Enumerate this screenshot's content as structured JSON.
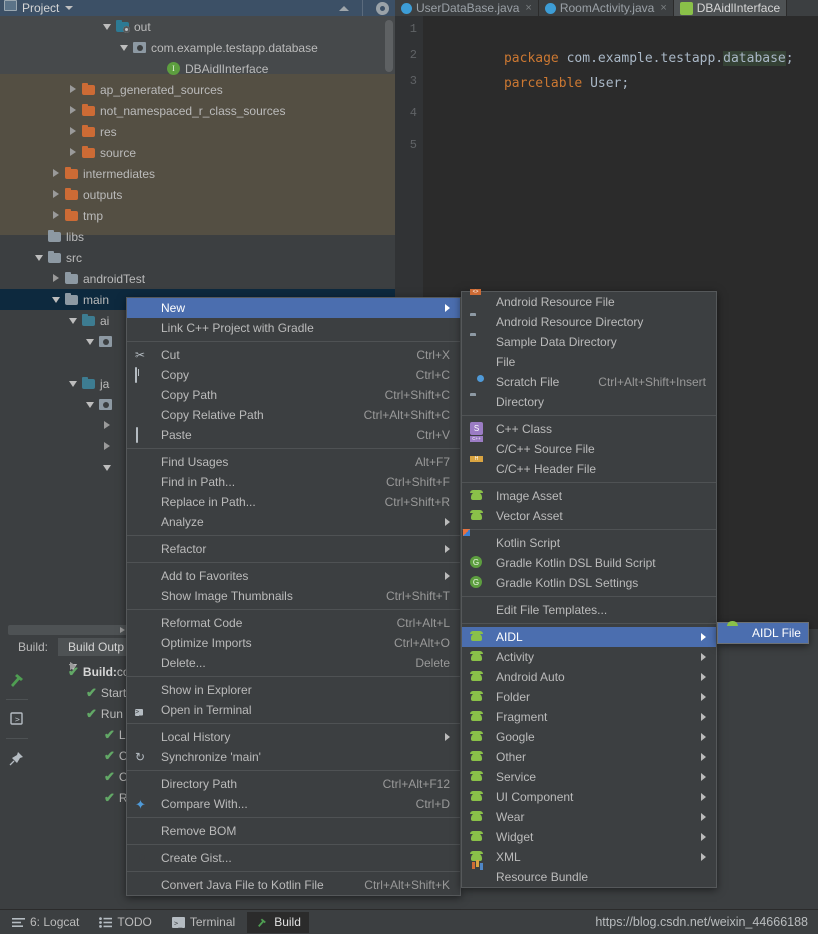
{
  "project_toolbar": {
    "title": "Project",
    "collapse_icon": "collapse-all-icon",
    "settings_icon": "gear-icon"
  },
  "project_tree": {
    "items": [
      {
        "indent": 6,
        "twisty": "down",
        "icon": "folder-out",
        "label": "out",
        "band": "out"
      },
      {
        "indent": 7,
        "twisty": "down",
        "icon": "package",
        "label": "com.example.testapp.database",
        "band": "out"
      },
      {
        "indent": 9,
        "twisty": "none",
        "icon": "interface",
        "label": "DBAidlInterface",
        "band": "out"
      },
      {
        "indent": 4,
        "twisty": "right",
        "icon": "folder-orange",
        "label": "ap_generated_sources",
        "band": "olive"
      },
      {
        "indent": 4,
        "twisty": "right",
        "icon": "folder-orange",
        "label": "not_namespaced_r_class_sources",
        "band": "olive"
      },
      {
        "indent": 4,
        "twisty": "right",
        "icon": "folder-orange",
        "label": "res",
        "band": "olive"
      },
      {
        "indent": 4,
        "twisty": "right",
        "icon": "folder-orange",
        "label": "source",
        "band": "olive"
      },
      {
        "indent": 3,
        "twisty": "right",
        "icon": "folder-orange",
        "label": "intermediates",
        "band": "olive"
      },
      {
        "indent": 3,
        "twisty": "right",
        "icon": "folder-orange",
        "label": "outputs",
        "band": "olive"
      },
      {
        "indent": 3,
        "twisty": "right",
        "icon": "folder-orange",
        "label": "tmp",
        "band": "olive"
      },
      {
        "indent": 2,
        "twisty": "none",
        "icon": "folder-grey",
        "label": "libs",
        "band": "none"
      },
      {
        "indent": 2,
        "twisty": "down",
        "icon": "folder-grey",
        "label": "src",
        "band": "none"
      },
      {
        "indent": 3,
        "twisty": "right",
        "icon": "folder-grey",
        "label": "androidTest",
        "band": "none"
      },
      {
        "indent": 3,
        "twisty": "down",
        "icon": "folder-grey",
        "label": "main",
        "band": "selected"
      },
      {
        "indent": 4,
        "twisty": "down",
        "icon": "folder-teal",
        "label": "ai",
        "band": "none"
      },
      {
        "indent": 5,
        "twisty": "down",
        "icon": "package",
        "label": "",
        "band": "none"
      },
      {
        "indent": 4,
        "twisty": "none",
        "icon": "none",
        "label": "",
        "band": "none"
      },
      {
        "indent": 4,
        "twisty": "down",
        "icon": "folder-teal",
        "label": "ja",
        "band": "none"
      },
      {
        "indent": 5,
        "twisty": "down",
        "icon": "package",
        "label": "",
        "band": "none"
      },
      {
        "indent": 6,
        "twisty": "right",
        "icon": "none",
        "label": "",
        "band": "none"
      },
      {
        "indent": 6,
        "twisty": "right",
        "icon": "none",
        "label": "",
        "band": "none"
      },
      {
        "indent": 6,
        "twisty": "down",
        "icon": "none",
        "label": "",
        "band": "none"
      }
    ]
  },
  "editor": {
    "tabs": [
      {
        "label": "UserDataBase.java",
        "icon": "java-class-icon",
        "active": false
      },
      {
        "label": "RoomActivity.java",
        "icon": "java-class-icon",
        "active": false
      },
      {
        "label": "DBAidlInterface",
        "icon": "aidl-icon",
        "active": true
      }
    ],
    "line_numbers": [
      "1",
      "2",
      "3",
      "4",
      "5"
    ],
    "code": {
      "line2": {
        "keyword": "package",
        "rest": " com.example.testapp.",
        "highlight": "database",
        "tail": ";"
      },
      "line3": {
        "keyword": "parcelable",
        "rest": " User",
        "tail": ";"
      }
    }
  },
  "build_panel": {
    "tabs": [
      {
        "label": "Build:",
        "active": false
      },
      {
        "label": "Build Outp",
        "active": true
      }
    ],
    "side_icons": [
      "hammer-icon",
      "restart-icon",
      "pin-icon"
    ],
    "tree": [
      {
        "indent": 0,
        "twisty": "down",
        "check": true,
        "bold": "Build:",
        "label": " co"
      },
      {
        "indent": 1,
        "twisty": "none",
        "check": true,
        "bold": "",
        "label": "Startin"
      },
      {
        "indent": 1,
        "twisty": "down",
        "check": true,
        "bold": "",
        "label": "Run b"
      },
      {
        "indent": 2,
        "twisty": "right",
        "check": true,
        "bold": "",
        "label": "Loa"
      },
      {
        "indent": 2,
        "twisty": "right",
        "check": true,
        "bold": "",
        "label": "Co"
      },
      {
        "indent": 2,
        "twisty": "none",
        "check": true,
        "bold": "",
        "label": "Cal"
      },
      {
        "indent": 2,
        "twisty": "right",
        "check": true,
        "bold": "",
        "label": "Run"
      }
    ]
  },
  "status_bar": {
    "items": [
      {
        "label": "6: Logcat",
        "icon": "logcat-icon",
        "active": false
      },
      {
        "label": "TODO",
        "icon": "todo-icon",
        "active": false
      },
      {
        "label": "Terminal",
        "icon": "terminal-icon",
        "active": false
      },
      {
        "label": "Build",
        "icon": "hammer-icon",
        "active": true
      }
    ]
  },
  "watermark": "https://blog.csdn.net/weixin_44666188",
  "context_menu": {
    "items": [
      {
        "label": "New",
        "key": "",
        "icon": "none",
        "submenu": true,
        "selected": true,
        "mnemonic": "N"
      },
      {
        "label": "Link C++ Project with Gradle",
        "key": "",
        "icon": "none",
        "submenu": false
      },
      {
        "sep": true
      },
      {
        "label": "Cut",
        "key": "Ctrl+X",
        "icon": "scissors-icon",
        "submenu": false
      },
      {
        "label": "Copy",
        "key": "Ctrl+C",
        "icon": "copy-icon",
        "submenu": false
      },
      {
        "label": "Copy Path",
        "key": "Ctrl+Shift+C",
        "icon": "none",
        "submenu": false
      },
      {
        "label": "Copy Relative Path",
        "key": "Ctrl+Alt+Shift+C",
        "icon": "none",
        "submenu": false
      },
      {
        "label": "Paste",
        "key": "Ctrl+V",
        "icon": "clipboard-icon",
        "submenu": false
      },
      {
        "sep": true
      },
      {
        "label": "Find Usages",
        "key": "Alt+F7",
        "icon": "none",
        "submenu": false
      },
      {
        "label": "Find in Path...",
        "key": "Ctrl+Shift+F",
        "icon": "none",
        "submenu": false
      },
      {
        "label": "Replace in Path...",
        "key": "Ctrl+Shift+R",
        "icon": "none",
        "submenu": false
      },
      {
        "label": "Analyze",
        "key": "",
        "icon": "none",
        "submenu": true
      },
      {
        "sep": true
      },
      {
        "label": "Refactor",
        "key": "",
        "icon": "none",
        "submenu": true
      },
      {
        "sep": true
      },
      {
        "label": "Add to Favorites",
        "key": "",
        "icon": "none",
        "submenu": true
      },
      {
        "label": "Show Image Thumbnails",
        "key": "Ctrl+Shift+T",
        "icon": "none",
        "submenu": false
      },
      {
        "sep": true
      },
      {
        "label": "Reformat Code",
        "key": "Ctrl+Alt+L",
        "icon": "none",
        "submenu": false
      },
      {
        "label": "Optimize Imports",
        "key": "Ctrl+Alt+O",
        "icon": "none",
        "submenu": false
      },
      {
        "label": "Delete...",
        "key": "Delete",
        "icon": "none",
        "submenu": false
      },
      {
        "sep": true
      },
      {
        "label": "Show in Explorer",
        "key": "",
        "icon": "none",
        "submenu": false
      },
      {
        "label": "Open in Terminal",
        "key": "",
        "icon": "terminal-icon",
        "submenu": false
      },
      {
        "sep": true
      },
      {
        "label": "Local History",
        "key": "",
        "icon": "none",
        "submenu": true
      },
      {
        "label": "Synchronize 'main'",
        "key": "",
        "icon": "sync-icon",
        "submenu": false
      },
      {
        "sep": true
      },
      {
        "label": "Directory Path",
        "key": "Ctrl+Alt+F12",
        "icon": "none",
        "submenu": false
      },
      {
        "label": "Compare With...",
        "key": "Ctrl+D",
        "icon": "compare-icon",
        "submenu": false
      },
      {
        "sep": true
      },
      {
        "label": "Remove BOM",
        "key": "",
        "icon": "none",
        "submenu": false
      },
      {
        "sep": true
      },
      {
        "label": "Create Gist...",
        "key": "",
        "icon": "github-icon",
        "submenu": false
      },
      {
        "sep": true
      },
      {
        "label": "Convert Java File to Kotlin File",
        "key": "Ctrl+Alt+Shift+K",
        "icon": "none",
        "submenu": false
      }
    ]
  },
  "new_submenu": {
    "items": [
      {
        "label": "Android Resource File",
        "key": "",
        "icon": "res-file-icon",
        "submenu": false
      },
      {
        "label": "Android Resource Directory",
        "key": "",
        "icon": "folder-icon",
        "submenu": false
      },
      {
        "label": "Sample Data Directory",
        "key": "",
        "icon": "folder-icon",
        "submenu": false
      },
      {
        "label": "File",
        "key": "",
        "icon": "file-icon",
        "submenu": false
      },
      {
        "label": "Scratch File",
        "key": "Ctrl+Alt+Shift+Insert",
        "icon": "scratch-file-icon",
        "submenu": false
      },
      {
        "label": "Directory",
        "key": "",
        "icon": "folder-icon",
        "submenu": false
      },
      {
        "sep": true
      },
      {
        "label": "C++ Class",
        "key": "",
        "icon": "cpp-class-icon",
        "submenu": false
      },
      {
        "label": "C/C++ Source File",
        "key": "",
        "icon": "cpp-source-icon",
        "submenu": false
      },
      {
        "label": "C/C++ Header File",
        "key": "",
        "icon": "cpp-header-icon",
        "submenu": false
      },
      {
        "sep": true
      },
      {
        "label": "Image Asset",
        "key": "",
        "icon": "android-icon",
        "submenu": false
      },
      {
        "label": "Vector Asset",
        "key": "",
        "icon": "android-icon",
        "submenu": false
      },
      {
        "sep": true
      },
      {
        "label": "Kotlin Script",
        "key": "",
        "icon": "kotlin-icon",
        "submenu": false
      },
      {
        "label": "Gradle Kotlin DSL Build Script",
        "key": "",
        "icon": "gradle-icon",
        "submenu": false
      },
      {
        "label": "Gradle Kotlin DSL Settings",
        "key": "",
        "icon": "gradle-icon",
        "submenu": false
      },
      {
        "sep": true
      },
      {
        "label": "Edit File Templates...",
        "key": "",
        "icon": "none",
        "submenu": false
      },
      {
        "sep": true
      },
      {
        "label": "AIDL",
        "key": "",
        "icon": "android-icon",
        "submenu": true,
        "selected": true
      },
      {
        "label": "Activity",
        "key": "",
        "icon": "android-icon",
        "submenu": true
      },
      {
        "label": "Android Auto",
        "key": "",
        "icon": "android-icon",
        "submenu": true
      },
      {
        "label": "Folder",
        "key": "",
        "icon": "android-icon",
        "submenu": true
      },
      {
        "label": "Fragment",
        "key": "",
        "icon": "android-icon",
        "submenu": true
      },
      {
        "label": "Google",
        "key": "",
        "icon": "android-icon",
        "submenu": true
      },
      {
        "label": "Other",
        "key": "",
        "icon": "android-icon",
        "submenu": true
      },
      {
        "label": "Service",
        "key": "",
        "icon": "android-icon",
        "submenu": true
      },
      {
        "label": "UI Component",
        "key": "",
        "icon": "android-icon",
        "submenu": true
      },
      {
        "label": "Wear",
        "key": "",
        "icon": "android-icon",
        "submenu": true
      },
      {
        "label": "Widget",
        "key": "",
        "icon": "android-icon",
        "submenu": true
      },
      {
        "label": "XML",
        "key": "",
        "icon": "android-icon",
        "submenu": true
      },
      {
        "label": "Resource Bundle",
        "key": "",
        "icon": "resource-bundle-icon",
        "submenu": false
      }
    ]
  },
  "aidl_submenu": {
    "items": [
      {
        "label": "AIDL File",
        "key": "",
        "icon": "aidl-file-icon",
        "selected": true
      }
    ]
  },
  "colors": {
    "menu_bg": "#3c3f41",
    "menu_highlight": "#4b6eaf",
    "tree_selected": "#0d293e",
    "olive_band": "#544f43",
    "editor_bg": "#2b2b2b",
    "keyword": "#cc7832",
    "identifier": "#a9b7c6",
    "android_green": "#8ac149",
    "check_green": "#62a866"
  }
}
